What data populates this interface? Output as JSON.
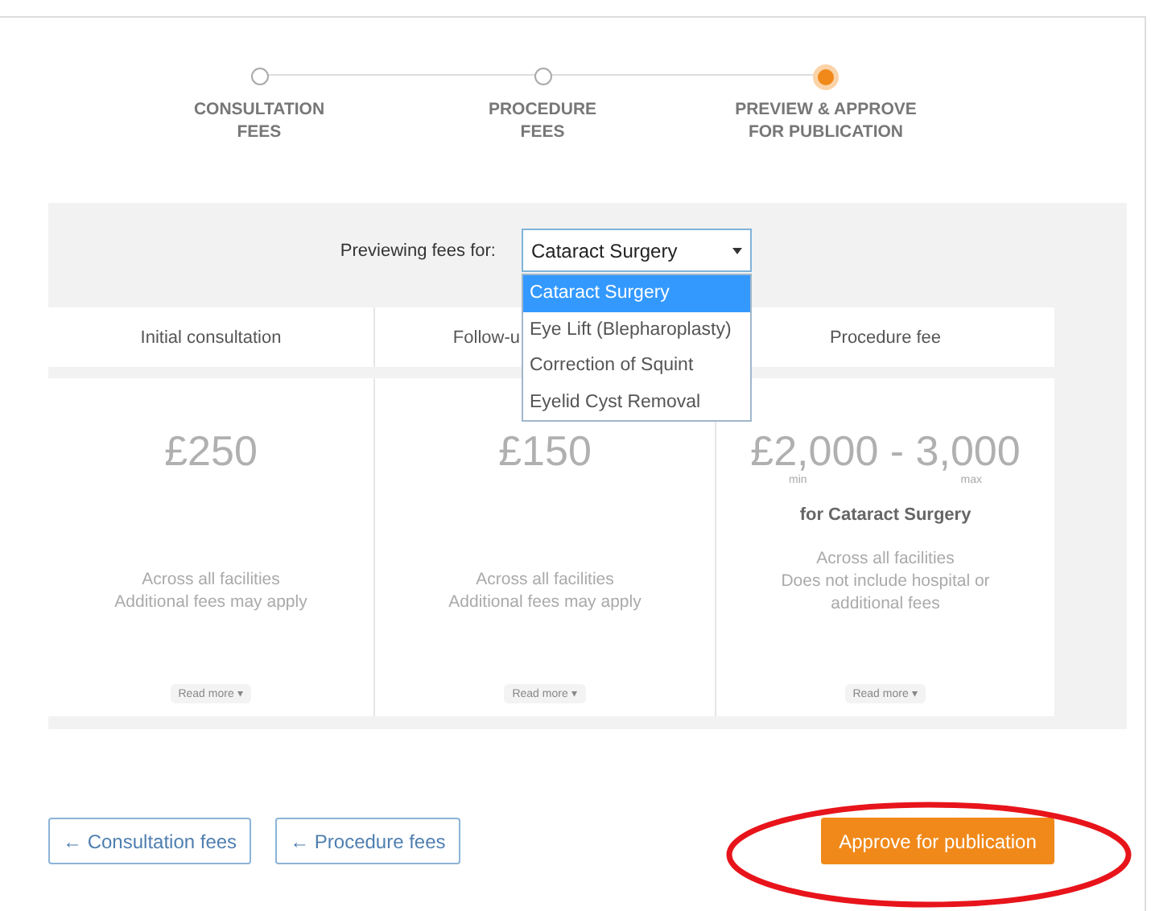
{
  "stepper": [
    {
      "label": "CONSULTATION\nFEES",
      "selected": false
    },
    {
      "label": "PROCEDURE\nFEES",
      "selected": false
    },
    {
      "label": "PREVIEW & APPROVE\nFOR PUBLICATION",
      "selected": true
    }
  ],
  "preview": {
    "label": "Previewing fees for:",
    "value": "Cataract Surgery",
    "expanded": true,
    "options": [
      {
        "label": "Cataract Surgery",
        "selected": true
      },
      {
        "label": "Eye Lift (Blepharoplasty)",
        "selected": false
      },
      {
        "label": "Correction of Squint",
        "selected": false
      },
      {
        "label": "Eyelid Cyst Removal",
        "selected": false
      }
    ]
  },
  "cards": [
    {
      "header": "Initial consultation",
      "amount": "£250",
      "notes": [
        "Across all facilities",
        "Additional fees may apply"
      ],
      "read_more": "Read more ▾"
    },
    {
      "header": "Follow-u",
      "amount": "£150",
      "notes": [
        "Across all facilities",
        "Additional fees may apply"
      ],
      "read_more": "Read more ▾"
    },
    {
      "header": "Procedure fee",
      "amount": "£2,000 - 3,000",
      "min_label": "min",
      "max_label": "max",
      "procedure": "for Cataract Surgery",
      "notes": [
        "Across all facilities",
        "Does not include hospital or additional fees"
      ],
      "read_more": "Read more ▾"
    }
  ],
  "back_buttons": [
    "← Consultation fees",
    "← Procedure fees"
  ],
  "approve_button": "Approve for publication"
}
